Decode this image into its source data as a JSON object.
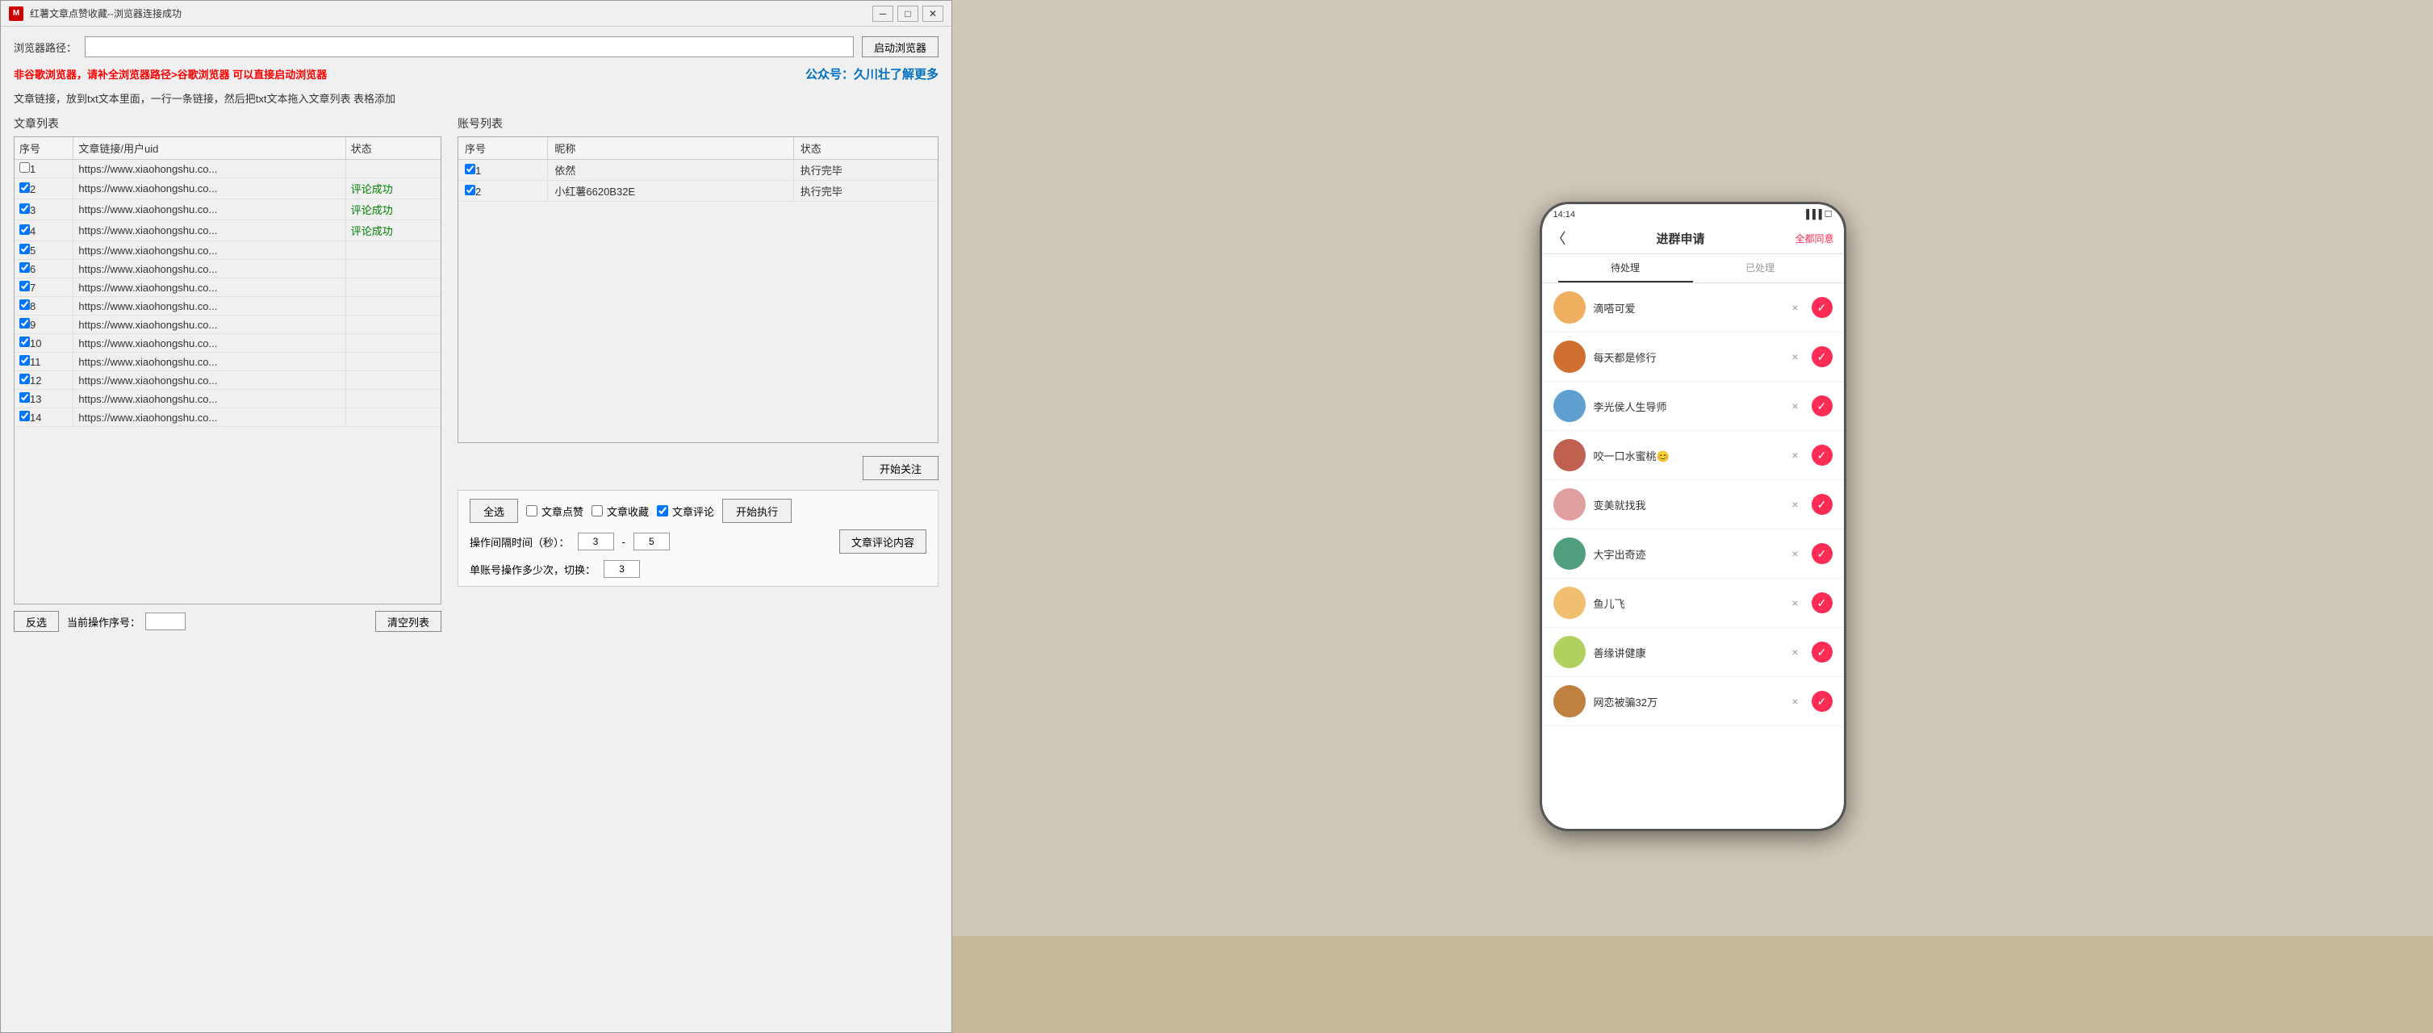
{
  "window": {
    "title": "红薯文章点赞收藏--浏览器连接成功",
    "icon": "M"
  },
  "browser_row": {
    "label": "浏览器路径：",
    "input_value": "",
    "input_placeholder": "",
    "start_btn": "启动浏览器"
  },
  "notice": {
    "warning": "非谷歌浏览器，请补全浏览器路径>谷歌浏览器 可以直接启动浏览器",
    "public": "公众号：久川壮了解更多"
  },
  "instruction": "文章链接，放到txt文本里面，一行一条链接，然后把txt文本拖入文章列表 表格添加",
  "article_panel": {
    "title": "文章列表",
    "columns": [
      "序号",
      "文章链接/用户uid",
      "状态"
    ],
    "rows": [
      {
        "id": 1,
        "checked": false,
        "url": "https://www.xiaohongshu.co...",
        "status": ""
      },
      {
        "id": 2,
        "checked": true,
        "url": "https://www.xiaohongshu.co...",
        "status": "评论成功"
      },
      {
        "id": 3,
        "checked": true,
        "url": "https://www.xiaohongshu.co...",
        "status": "评论成功"
      },
      {
        "id": 4,
        "checked": true,
        "url": "https://www.xiaohongshu.co...",
        "status": "评论成功"
      },
      {
        "id": 5,
        "checked": true,
        "url": "https://www.xiaohongshu.co...",
        "status": ""
      },
      {
        "id": 6,
        "checked": true,
        "url": "https://www.xiaohongshu.co...",
        "status": ""
      },
      {
        "id": 7,
        "checked": true,
        "url": "https://www.xiaohongshu.co...",
        "status": ""
      },
      {
        "id": 8,
        "checked": true,
        "url": "https://www.xiaohongshu.co...",
        "status": ""
      },
      {
        "id": 9,
        "checked": true,
        "url": "https://www.xiaohongshu.co...",
        "status": ""
      },
      {
        "id": 10,
        "checked": true,
        "url": "https://www.xiaohongshu.co...",
        "status": ""
      },
      {
        "id": 11,
        "checked": true,
        "url": "https://www.xiaohongshu.co...",
        "status": ""
      },
      {
        "id": 12,
        "checked": true,
        "url": "https://www.xiaohongshu.co...",
        "status": ""
      },
      {
        "id": 13,
        "checked": true,
        "url": "https://www.xiaohongshu.co...",
        "status": ""
      },
      {
        "id": 14,
        "checked": true,
        "url": "https://www.xiaohongshu.co...",
        "status": ""
      }
    ],
    "reverse_btn": "反选",
    "current_op_label": "当前操作序号：",
    "current_op_value": "",
    "clear_btn": "清空列表"
  },
  "account_panel": {
    "title": "账号列表",
    "columns": [
      "序号",
      "昵称",
      "状态"
    ],
    "rows": [
      {
        "id": 1,
        "checked": true,
        "nickname": "依然",
        "status": "执行完毕"
      },
      {
        "id": 2,
        "checked": true,
        "nickname": "小红薯6620B32E",
        "status": "执行完毕"
      }
    ],
    "start_follow_btn": "开始关注"
  },
  "bottom_controls": {
    "select_all_btn": "全选",
    "article_like_label": "文章点赞",
    "article_like_checked": false,
    "article_collect_label": "文章收藏",
    "article_collect_checked": false,
    "article_comment_label": "文章评论",
    "article_comment_checked": true,
    "start_execute_btn": "开始执行",
    "interval_label": "操作间隔时间（秒）：",
    "interval_min": "3",
    "interval_dash": "-",
    "interval_max": "5",
    "comment_content_btn": "文章评论内容",
    "switch_label": "单账号操作多少次，切换：",
    "switch_value": "3"
  },
  "phone": {
    "status_time": "14:14",
    "nav_back": "〈",
    "nav_title": "进群申请",
    "nav_btn": "全都同意",
    "tabs": [
      "待处理",
      "已处理"
    ],
    "active_tab": 0,
    "list_items": [
      {
        "name": "滴嗒可爱",
        "avatar_color": "#f0b060"
      },
      {
        "name": "每天都是修行",
        "avatar_color": "#d07030"
      },
      {
        "name": "李光侯人生导师",
        "avatar_color": "#60a0d0"
      },
      {
        "name": "咬一口水蜜桃😊",
        "avatar_color": "#c06050"
      },
      {
        "name": "变美就找我",
        "avatar_color": "#e0a0a0"
      },
      {
        "name": "大宇出奇迹",
        "avatar_color": "#50a080"
      },
      {
        "name": "鱼儿飞",
        "avatar_color": "#f0c070"
      },
      {
        "name": "善缘讲健康",
        "avatar_color": "#b0d060"
      },
      {
        "name": "网恋被骗32万",
        "avatar_color": "#c08040"
      }
    ]
  }
}
